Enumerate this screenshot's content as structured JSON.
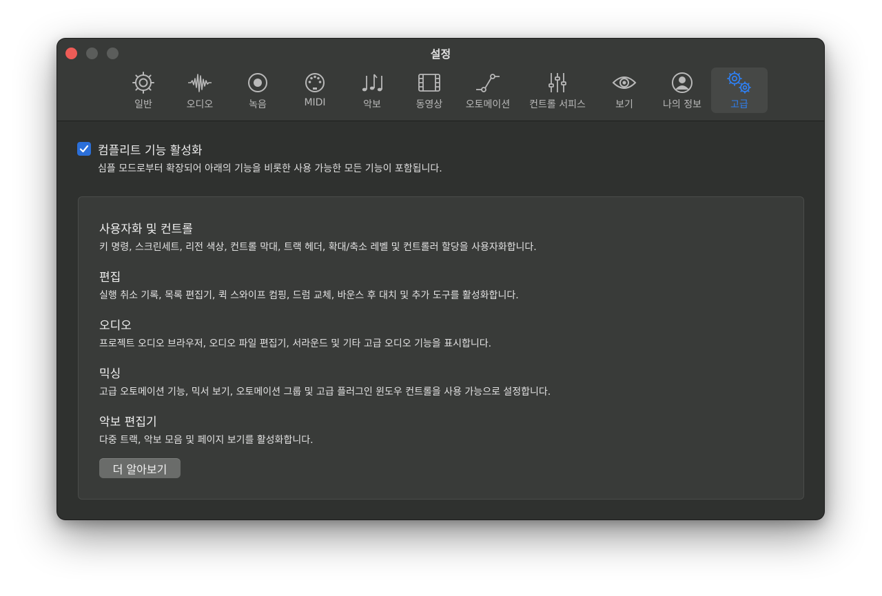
{
  "window": {
    "title": "설정"
  },
  "tabs": [
    {
      "label": "일반",
      "icon": "gear-icon"
    },
    {
      "label": "오디오",
      "icon": "waveform-icon"
    },
    {
      "label": "녹음",
      "icon": "record-icon"
    },
    {
      "label": "MIDI",
      "icon": "midi-port-icon"
    },
    {
      "label": "악보",
      "icon": "music-notes-icon"
    },
    {
      "label": "동영상",
      "icon": "film-icon"
    },
    {
      "label": "오토메이션",
      "icon": "automation-curve-icon"
    },
    {
      "label": "컨트롤 서피스",
      "icon": "sliders-icon"
    },
    {
      "label": "보기",
      "icon": "eye-icon"
    },
    {
      "label": "나의 정보",
      "icon": "person-icon"
    },
    {
      "label": "고급",
      "icon": "gears-icon",
      "active": true
    }
  ],
  "colors": {
    "accent": "#2f7ff0",
    "checkbox": "#2b6fd9",
    "close": "#ee5c57"
  },
  "complete": {
    "checked": true,
    "label": "컴플리트 기능 활성화",
    "description": "심플 모드로부터 확장되어 아래의 기능을 비롯한 사용 가능한 모든 기능이 포함됩니다."
  },
  "sections": [
    {
      "title": "사용자화 및 컨트롤",
      "description": "키 명령, 스크린세트, 리전 색상, 컨트롤 막대, 트랙 헤더, 확대/축소 레벨 및 컨트롤러 할당을 사용자화합니다."
    },
    {
      "title": "편집",
      "description": "실행 취소 기록, 목록 편집기, 퀵 스와이프 컴핑, 드럼 교체, 바운스 후 대치 및 추가 도구를 활성화합니다."
    },
    {
      "title": "오디오",
      "description": "프로젝트 오디오 브라우저, 오디오 파일 편집기, 서라운드 및 기타 고급 오디오 기능을 표시합니다."
    },
    {
      "title": "믹싱",
      "description": "고급 오토메이션 기능, 믹서 보기, 오토메이션 그룹 및 고급 플러그인 윈도우 컨트롤을 사용 가능으로 설정합니다."
    },
    {
      "title": "악보 편집기",
      "description": "다중 트랙, 악보 모음 및 페이지 보기를 활성화합니다."
    }
  ],
  "learn_more": {
    "label": "더 알아보기"
  }
}
